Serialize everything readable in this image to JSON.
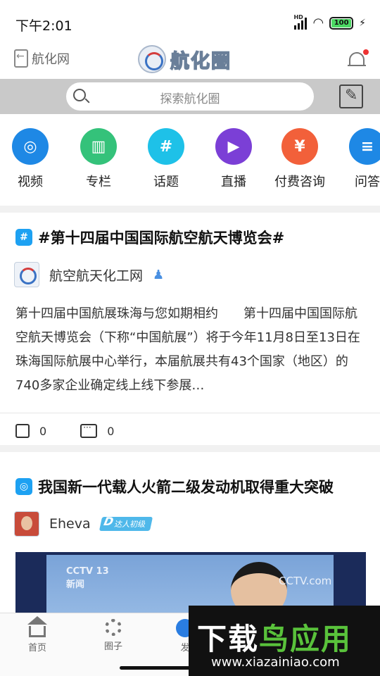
{
  "status_bar": {
    "time": "下午2:01",
    "signal_label": "HD",
    "battery": "100"
  },
  "nav": {
    "back_label": "航化网",
    "logo_text": "航化圈"
  },
  "search": {
    "placeholder": "探索航化圈"
  },
  "categories": [
    {
      "label": "视频",
      "color": "#1e88e5",
      "icon": "film-reel-icon",
      "glyph": "◎"
    },
    {
      "label": "专栏",
      "color": "#34c27a",
      "icon": "book-icon",
      "glyph": "▥"
    },
    {
      "label": "话题",
      "color": "#1ec1e8",
      "icon": "hashtag-icon",
      "glyph": "#"
    },
    {
      "label": "直播",
      "color": "#7b3fd6",
      "icon": "video-camera-icon",
      "glyph": "▶"
    },
    {
      "label": "付费咨询",
      "color": "#f2603a",
      "icon": "lock-icon",
      "glyph": "¥"
    },
    {
      "label": "问答",
      "color": "#1e88e5",
      "icon": "qa-icon",
      "glyph": "≡"
    }
  ],
  "posts": [
    {
      "title": "#第十四届中国国际航空航天博览会#",
      "tag_icon": "topic-tag-icon",
      "author": "航空航天化工网",
      "body": "第十四届中国航展珠海与您如期相约　　第十四届中国国际航空航天博览会（下称“中国航展”）将于今年11月8日至13日在珠海国际航展中心举行，本届航展共有43个国家（地区）的740多家企业确定线上线下参展…",
      "likes": "0",
      "comments": "0"
    },
    {
      "title": "我国新一代载人火箭二级发动机取得重大突破",
      "tag_icon": "video-tag-icon",
      "author": "Eheva",
      "badge": "达人初级",
      "video": {
        "channel": "CCTV 13",
        "channel_sub": "新闻",
        "corner_logo": "CCTV.com"
      }
    }
  ],
  "tabs": [
    {
      "label": "首页"
    },
    {
      "label": "圈子"
    },
    {
      "label": "发"
    }
  ],
  "watermark": {
    "title_a": "下载",
    "title_b": "鸟应用",
    "url": "www.xiazainiao.com"
  }
}
